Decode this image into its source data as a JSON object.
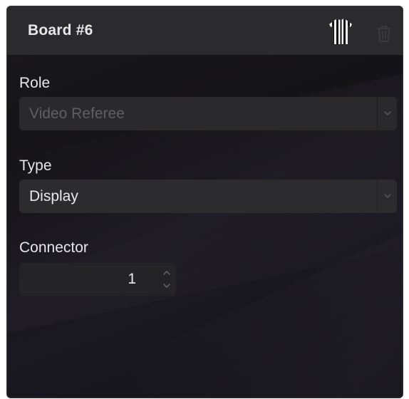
{
  "header": {
    "title": "Board #6"
  },
  "icons": {
    "jersey": "referee-jersey-icon",
    "trash": "trash-icon",
    "select_arrow": "chevron-down-icon",
    "stepper_up": "chevron-up-icon",
    "stepper_down": "chevron-down-icon"
  },
  "fields": {
    "role": {
      "label": "Role",
      "value": "Video Referee",
      "disabled": true
    },
    "type": {
      "label": "Type",
      "value": "Display",
      "disabled": false
    },
    "connector": {
      "label": "Connector",
      "value": "1"
    }
  },
  "colors": {
    "header_bg": "#2b2b2d",
    "panel_bg": "#161519",
    "text": "#e8e8ea",
    "disabled_text": "#5f5f63",
    "field_bg": "#2c2c2f"
  }
}
